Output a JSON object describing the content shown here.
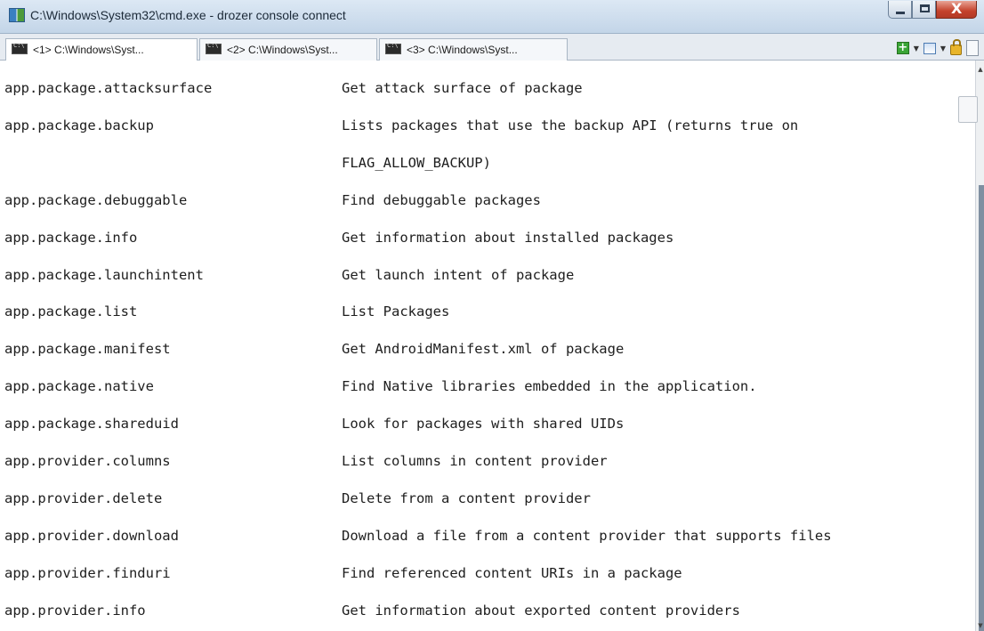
{
  "window": {
    "title": "C:\\Windows\\System32\\cmd.exe - drozer  console connect",
    "close_symbol": "X"
  },
  "tabs": [
    {
      "label": "<1> C:\\Windows\\Syst...",
      "active": true
    },
    {
      "label": "<2> C:\\Windows\\Syst...",
      "active": false
    },
    {
      "label": "<3> C:\\Windows\\Syst...",
      "active": false
    }
  ],
  "toolbar": {
    "new_tab_symbol": "+",
    "icons": [
      "new-console-icon",
      "dropdown-arrow-icon",
      "window-icon",
      "dropdown-arrow-icon",
      "lock-icon",
      "pane-icon"
    ]
  },
  "console": {
    "rows": [
      {
        "command": "app.package.attacksurface",
        "description": "Get attack surface of package"
      },
      {
        "command": "app.package.backup",
        "description": "Lists packages that use the backup API (returns true on"
      },
      {
        "command": "",
        "description": "FLAG_ALLOW_BACKUP)"
      },
      {
        "command": "app.package.debuggable",
        "description": "Find debuggable packages"
      },
      {
        "command": "app.package.info",
        "description": "Get information about installed packages"
      },
      {
        "command": "app.package.launchintent",
        "description": "Get launch intent of package"
      },
      {
        "command": "app.package.list",
        "description": "List Packages"
      },
      {
        "command": "app.package.manifest",
        "description": "Get AndroidManifest.xml of package"
      },
      {
        "command": "app.package.native",
        "description": "Find Native libraries embedded in the application."
      },
      {
        "command": "app.package.shareduid",
        "description": "Look for packages with shared UIDs"
      },
      {
        "command": "app.provider.columns",
        "description": "List columns in content provider"
      },
      {
        "command": "app.provider.delete",
        "description": "Delete from a content provider"
      },
      {
        "command": "app.provider.download",
        "description": "Download a file from a content provider that supports files"
      },
      {
        "command": "app.provider.finduri",
        "description": "Find referenced content URIs in a package"
      },
      {
        "command": "app.provider.info",
        "description": "Get information about exported content providers"
      }
    ]
  },
  "scrollbar": {
    "up_symbol": "▲",
    "down_symbol": "▼"
  }
}
